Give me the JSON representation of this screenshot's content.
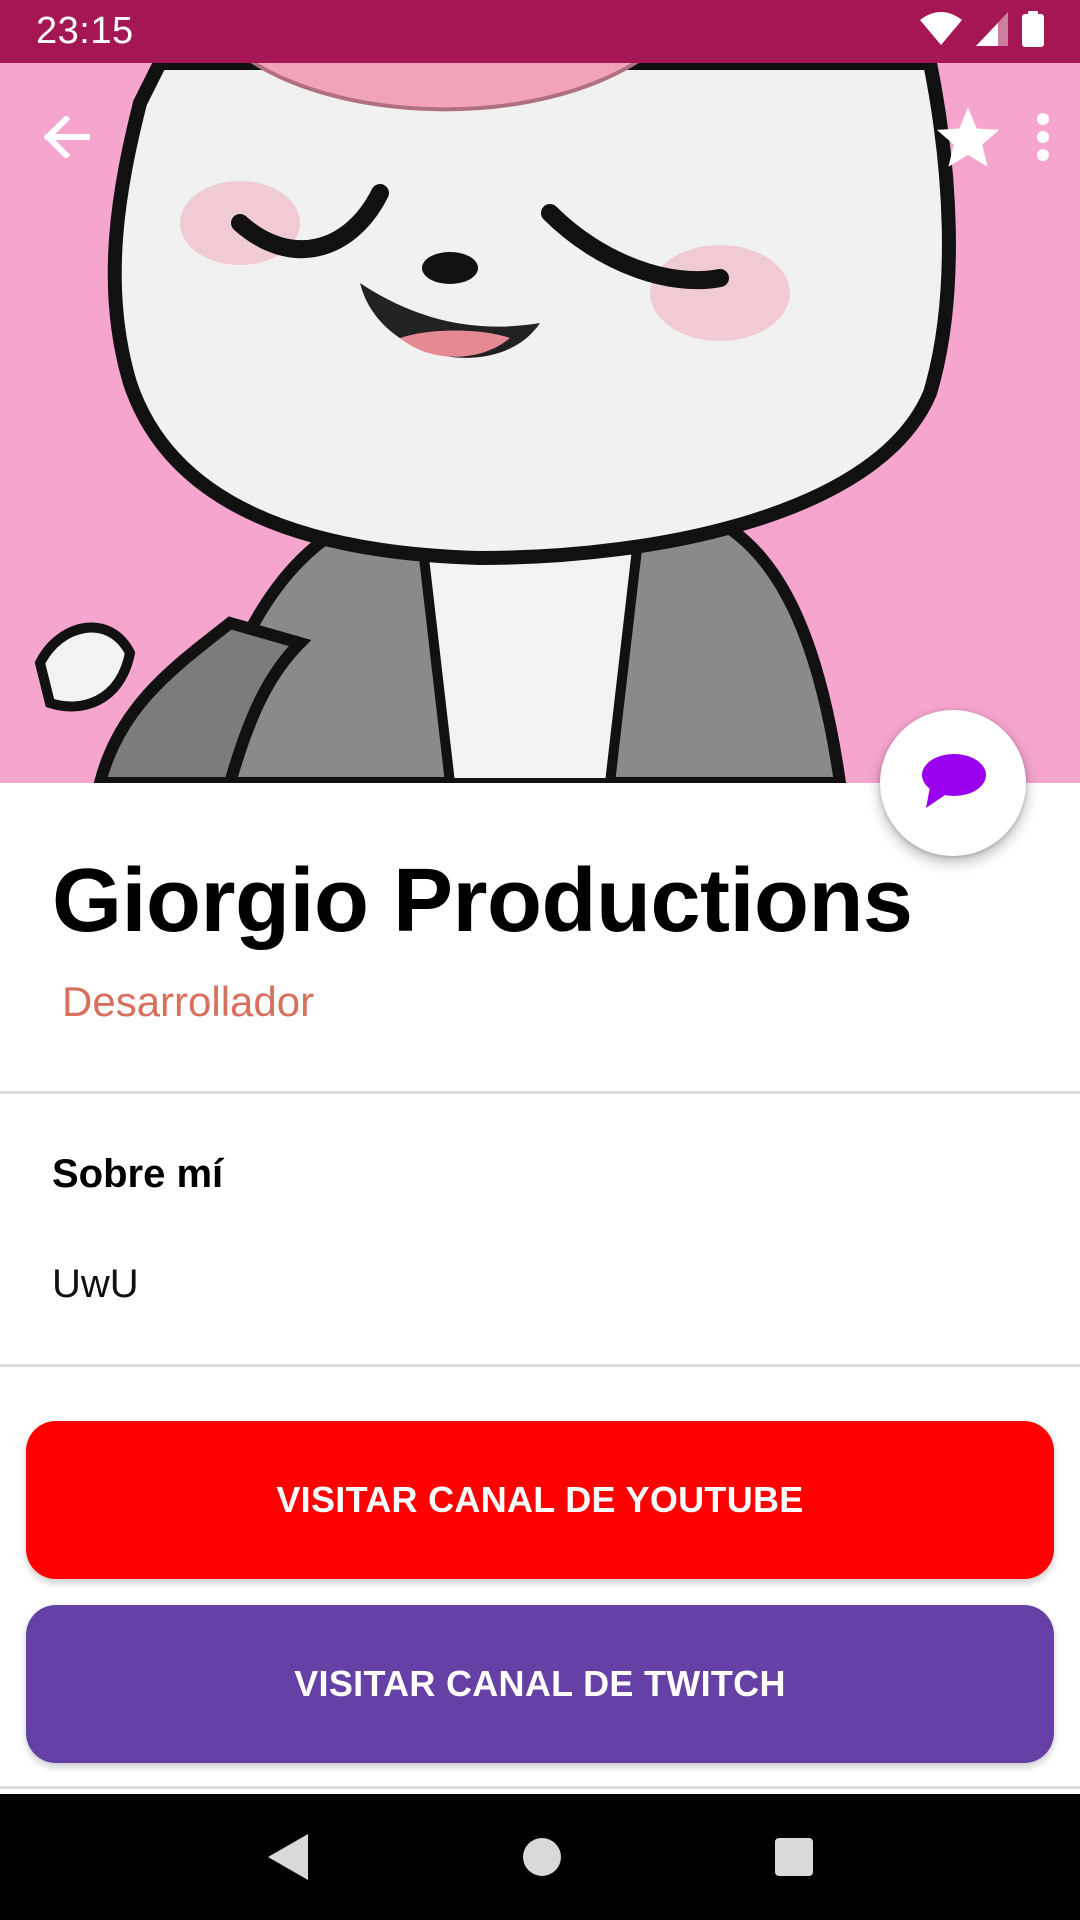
{
  "status_bar": {
    "time": "23:15",
    "background": "#a51655"
  },
  "toolbar": {
    "back_icon": "arrow-left-icon",
    "favorite_icon": "star-icon",
    "menu_icon": "more-vert-icon"
  },
  "header_image": {
    "icon": "cartoon-cat-illustration",
    "background": "#f6a5cf"
  },
  "fab": {
    "icon": "chat-bubble-icon",
    "icon_color": "#9a00ee"
  },
  "profile": {
    "name": "Giorgio Productions",
    "role": "Desarrollador",
    "role_color": "#d9705d"
  },
  "about": {
    "title": "Sobre mí",
    "text": "UwU"
  },
  "buttons": {
    "youtube_label": "VISITAR CANAL DE YOUTUBE",
    "youtube_color": "#fe0000",
    "twitch_label": "VISITAR CANAL DE TWITCH",
    "twitch_color": "#6541a5"
  },
  "nav_bar": {
    "back_icon": "nav-back-icon",
    "home_icon": "nav-home-icon",
    "recents_icon": "nav-recents-icon"
  }
}
